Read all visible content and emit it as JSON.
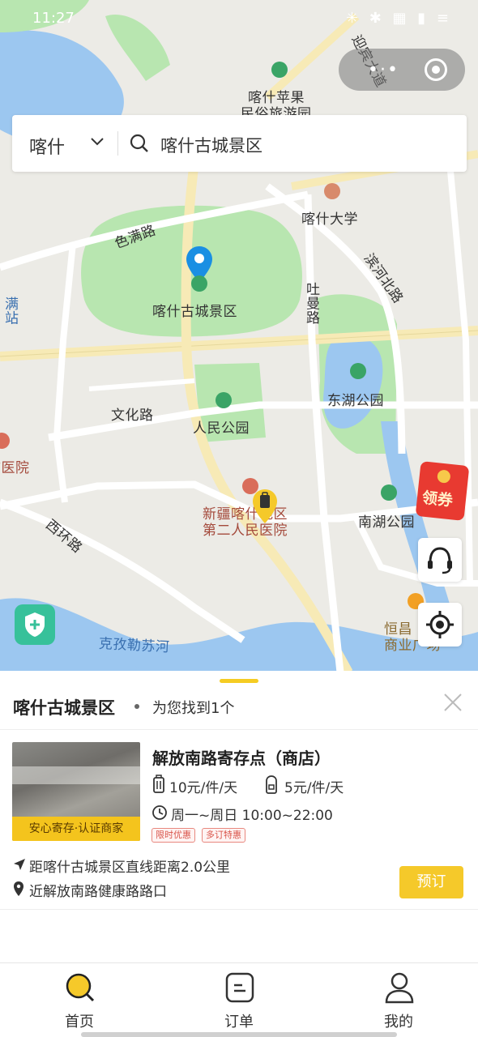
{
  "status_bar": {
    "time": "11:27",
    "system_icons": "✳ ✱ ▦ ▮ ≡"
  },
  "capsule": {
    "more_label": "•·•",
    "close_icon": "target-icon"
  },
  "search": {
    "city": "喀什",
    "query": "喀什古城景区"
  },
  "map": {
    "labels": {
      "kashgar_apple_inn": "喀什苹果",
      "kashgar_apple_inn_2": "民俗旅游园",
      "kashgar_university": "喀什大学",
      "seman_road": "色满路",
      "old_city": "喀什古城景区",
      "tuman_road": "吐曼路",
      "binhe_road": "滨河北路",
      "donghu_park": "东湖公园",
      "wenhua_road": "文化路",
      "renmin_park": "人民公园",
      "hospital_left": "市医院",
      "manzhan": "满站",
      "second_hospital_1": "新疆喀什地区",
      "second_hospital_2": "第二人民医院",
      "xihuan_road": "西环路",
      "nanhu_park": "南湖公园",
      "kezilesu_river": "克孜勒苏河",
      "hengchang_1": "恒昌",
      "hengchang_2": "商业广场",
      "diagonal_road": "迎宾大道"
    },
    "coupon_label": "领券",
    "colors": {
      "accent": "#f5c92a",
      "pin_blue": "#1a8fe3",
      "park_green": "#b8e6b0",
      "water_blue": "#9cc7f0"
    }
  },
  "sheet": {
    "title": "喀什古城景区",
    "count_text": "为您找到1个",
    "result": {
      "name": "解放南路寄存点（商店）",
      "price_large": "10元/件/天",
      "price_small": "5元/件/天",
      "hours": "周一~周日 10:00~22:00",
      "badges": [
        "限时优惠",
        "多订特惠"
      ],
      "thumb_tag": "安心寄存·认证商家",
      "distance": "距喀什古城景区直线距离2.0公里",
      "address": "近解放南路健康路路口",
      "book_label": "预订"
    }
  },
  "tabbar": {
    "items": [
      {
        "label": "首页",
        "icon": "search-icon"
      },
      {
        "label": "订单",
        "icon": "order-icon"
      },
      {
        "label": "我的",
        "icon": "user-icon"
      }
    ]
  }
}
